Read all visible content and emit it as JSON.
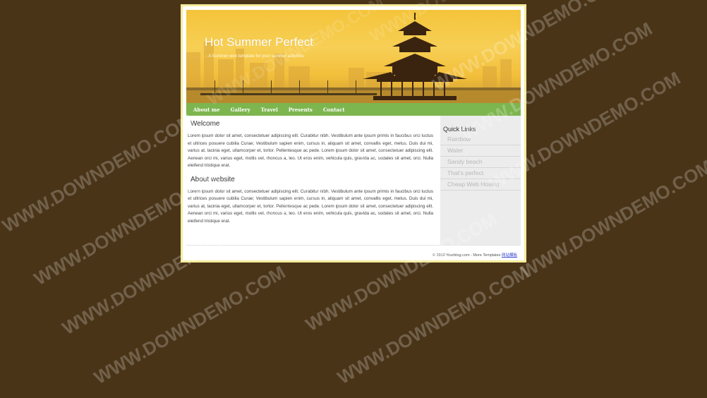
{
  "header": {
    "title": "Hot Summer Perfect",
    "tagline": "- A Summer web template for your summer activities"
  },
  "nav": [
    "About me",
    "Gallery",
    "Travel",
    "Presents",
    "Contact"
  ],
  "main": {
    "sections": [
      {
        "heading": "Welcome",
        "body": "Lorem ipsum dolor sit amet, consectetuer adipiscing elit. Curabitur nibh. Vestibulum ante ipsum primis in faucibus orci luctus et ultrices posuere cubilia Curae; Vestibulum sapien enim, cursus in, aliquam sit amet, convallis eget, metus. Duis dui mi, varius at, lacinia eget, ullamcorper et, tortor. Pellentesque ac pede. Lorem ipsum dolor sit amet, consectetuer adipiscing elit. Aenean orci mi, varius eget, mollis vel, rhoncus a, leo. Ut eros enim, vehicula quis, gravida ac, sodales sit amet, orci. Nulla eleifend tristique erat."
      },
      {
        "heading": "About website",
        "body": "Lorem ipsum dolor sit amet, consectetuer adipiscing elit. Curabitur nibh. Vestibulum ante ipsum primis in faucibus orci luctus et ultrices posuere cubilia Curae; Vestibulum sapien enim, cursus in, aliquam sit amet, convallis eget, metus. Duis dui mi, varius at, lacinia eget, ullamcorper et, tortor. Pellentesque ac pede. Lorem ipsum dolor sit amet, consectetuer adipiscing elit. Aenean orci mi, varius eget, mollis vel, rhoncus a, leo. Ut eros enim, vehicula quis, gravida ac, sodales sit amet, orci. Nulla eleifend tristique erat."
      }
    ]
  },
  "sidebar": {
    "title": "Quick Links",
    "links": [
      "Rainbow",
      "Water",
      "Sandy beach",
      "That's perfect",
      "Cheap Web Hosing"
    ]
  },
  "footer": {
    "copyright": "© 2010 Yourblog.com - More Templates",
    "link_text": "网站模板"
  },
  "watermark": "WWW.DOWNDEMO.COM",
  "colors": {
    "background": "#4a3418",
    "nav": "#7db54f",
    "banner": "#f4c43a",
    "frame": "#f4ec9c"
  }
}
